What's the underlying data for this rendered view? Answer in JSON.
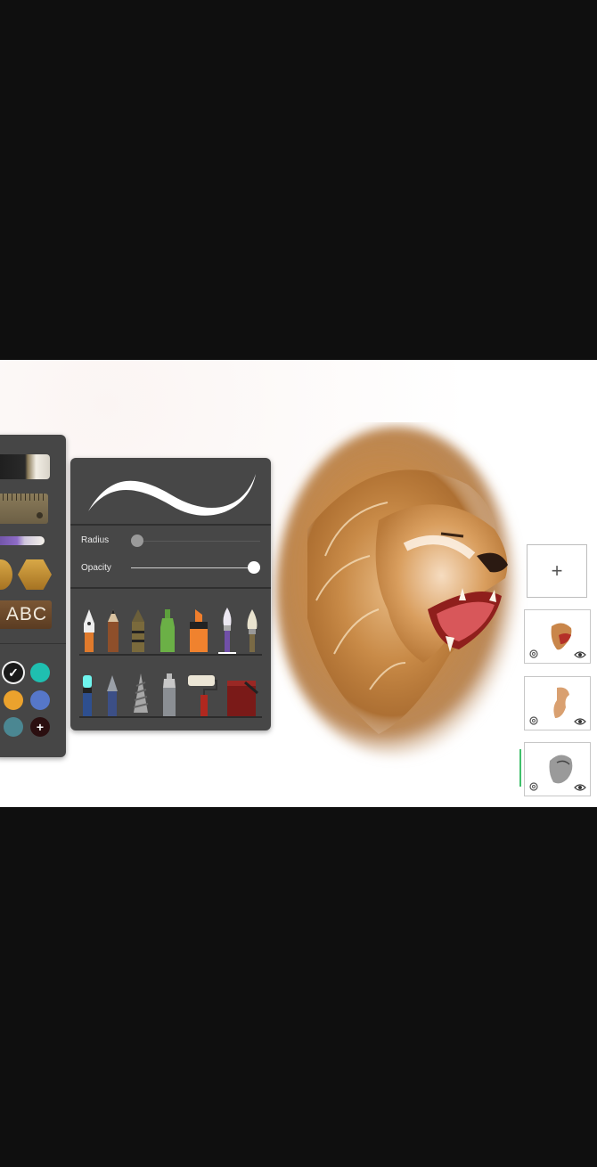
{
  "tools_panel": {
    "text_tool_label": "ABC",
    "colors": [
      "#1a1a1a",
      "#1fbfb0",
      "#eba22d",
      "#5677c9",
      "#4b8792",
      "#2b0f10"
    ],
    "selected_color": "#1a1a1a",
    "add_color_symbol": "+"
  },
  "brush_panel": {
    "radius_label": "Radius",
    "opacity_label": "Opacity",
    "radius_value": 0.0,
    "opacity_value": 1.0,
    "brushes_row1": [
      "fountain-pen",
      "pencil",
      "crayon",
      "marker-bottle",
      "highlighter",
      "paint-brush",
      "flat-brush"
    ],
    "brushes_row2": [
      "neon-pen",
      "ink-pen",
      "drill-brush",
      "spray-can",
      "paint-roller",
      "paint-bucket"
    ],
    "selected_brush": "paint-brush"
  },
  "layers_panel": {
    "add_layer_symbol": "+",
    "layers": [
      {
        "name": "lion-face-layer",
        "visible": true
      },
      {
        "name": "lion-body-layer",
        "visible": true
      },
      {
        "name": "lion-sketch-layer",
        "visible": true,
        "active": true
      }
    ]
  }
}
